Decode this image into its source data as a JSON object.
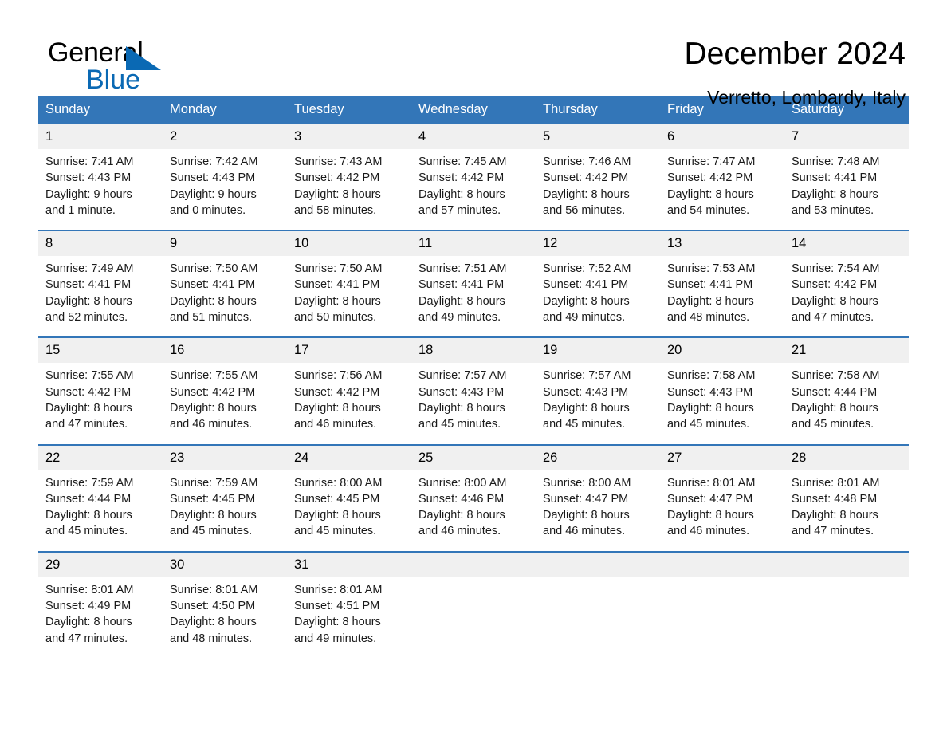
{
  "brand": {
    "name_part1": "General",
    "name_part2": "Blue",
    "accent_color": "#0a69b4"
  },
  "header": {
    "month_title": "December 2024",
    "location": "Verretto, Lombardy, Italy"
  },
  "calendar": {
    "header_color": "#3376b8",
    "day_band_color": "#f0f0f0",
    "weekdays": [
      "Sunday",
      "Monday",
      "Tuesday",
      "Wednesday",
      "Thursday",
      "Friday",
      "Saturday"
    ],
    "weeks": [
      [
        {
          "day": "1",
          "sunrise": "Sunrise: 7:41 AM",
          "sunset": "Sunset: 4:43 PM",
          "daylight_line1": "Daylight: 9 hours",
          "daylight_line2": "and 1 minute."
        },
        {
          "day": "2",
          "sunrise": "Sunrise: 7:42 AM",
          "sunset": "Sunset: 4:43 PM",
          "daylight_line1": "Daylight: 9 hours",
          "daylight_line2": "and 0 minutes."
        },
        {
          "day": "3",
          "sunrise": "Sunrise: 7:43 AM",
          "sunset": "Sunset: 4:42 PM",
          "daylight_line1": "Daylight: 8 hours",
          "daylight_line2": "and 58 minutes."
        },
        {
          "day": "4",
          "sunrise": "Sunrise: 7:45 AM",
          "sunset": "Sunset: 4:42 PM",
          "daylight_line1": "Daylight: 8 hours",
          "daylight_line2": "and 57 minutes."
        },
        {
          "day": "5",
          "sunrise": "Sunrise: 7:46 AM",
          "sunset": "Sunset: 4:42 PM",
          "daylight_line1": "Daylight: 8 hours",
          "daylight_line2": "and 56 minutes."
        },
        {
          "day": "6",
          "sunrise": "Sunrise: 7:47 AM",
          "sunset": "Sunset: 4:42 PM",
          "daylight_line1": "Daylight: 8 hours",
          "daylight_line2": "and 54 minutes."
        },
        {
          "day": "7",
          "sunrise": "Sunrise: 7:48 AM",
          "sunset": "Sunset: 4:41 PM",
          "daylight_line1": "Daylight: 8 hours",
          "daylight_line2": "and 53 minutes."
        }
      ],
      [
        {
          "day": "8",
          "sunrise": "Sunrise: 7:49 AM",
          "sunset": "Sunset: 4:41 PM",
          "daylight_line1": "Daylight: 8 hours",
          "daylight_line2": "and 52 minutes."
        },
        {
          "day": "9",
          "sunrise": "Sunrise: 7:50 AM",
          "sunset": "Sunset: 4:41 PM",
          "daylight_line1": "Daylight: 8 hours",
          "daylight_line2": "and 51 minutes."
        },
        {
          "day": "10",
          "sunrise": "Sunrise: 7:50 AM",
          "sunset": "Sunset: 4:41 PM",
          "daylight_line1": "Daylight: 8 hours",
          "daylight_line2": "and 50 minutes."
        },
        {
          "day": "11",
          "sunrise": "Sunrise: 7:51 AM",
          "sunset": "Sunset: 4:41 PM",
          "daylight_line1": "Daylight: 8 hours",
          "daylight_line2": "and 49 minutes."
        },
        {
          "day": "12",
          "sunrise": "Sunrise: 7:52 AM",
          "sunset": "Sunset: 4:41 PM",
          "daylight_line1": "Daylight: 8 hours",
          "daylight_line2": "and 49 minutes."
        },
        {
          "day": "13",
          "sunrise": "Sunrise: 7:53 AM",
          "sunset": "Sunset: 4:41 PM",
          "daylight_line1": "Daylight: 8 hours",
          "daylight_line2": "and 48 minutes."
        },
        {
          "day": "14",
          "sunrise": "Sunrise: 7:54 AM",
          "sunset": "Sunset: 4:42 PM",
          "daylight_line1": "Daylight: 8 hours",
          "daylight_line2": "and 47 minutes."
        }
      ],
      [
        {
          "day": "15",
          "sunrise": "Sunrise: 7:55 AM",
          "sunset": "Sunset: 4:42 PM",
          "daylight_line1": "Daylight: 8 hours",
          "daylight_line2": "and 47 minutes."
        },
        {
          "day": "16",
          "sunrise": "Sunrise: 7:55 AM",
          "sunset": "Sunset: 4:42 PM",
          "daylight_line1": "Daylight: 8 hours",
          "daylight_line2": "and 46 minutes."
        },
        {
          "day": "17",
          "sunrise": "Sunrise: 7:56 AM",
          "sunset": "Sunset: 4:42 PM",
          "daylight_line1": "Daylight: 8 hours",
          "daylight_line2": "and 46 minutes."
        },
        {
          "day": "18",
          "sunrise": "Sunrise: 7:57 AM",
          "sunset": "Sunset: 4:43 PM",
          "daylight_line1": "Daylight: 8 hours",
          "daylight_line2": "and 45 minutes."
        },
        {
          "day": "19",
          "sunrise": "Sunrise: 7:57 AM",
          "sunset": "Sunset: 4:43 PM",
          "daylight_line1": "Daylight: 8 hours",
          "daylight_line2": "and 45 minutes."
        },
        {
          "day": "20",
          "sunrise": "Sunrise: 7:58 AM",
          "sunset": "Sunset: 4:43 PM",
          "daylight_line1": "Daylight: 8 hours",
          "daylight_line2": "and 45 minutes."
        },
        {
          "day": "21",
          "sunrise": "Sunrise: 7:58 AM",
          "sunset": "Sunset: 4:44 PM",
          "daylight_line1": "Daylight: 8 hours",
          "daylight_line2": "and 45 minutes."
        }
      ],
      [
        {
          "day": "22",
          "sunrise": "Sunrise: 7:59 AM",
          "sunset": "Sunset: 4:44 PM",
          "daylight_line1": "Daylight: 8 hours",
          "daylight_line2": "and 45 minutes."
        },
        {
          "day": "23",
          "sunrise": "Sunrise: 7:59 AM",
          "sunset": "Sunset: 4:45 PM",
          "daylight_line1": "Daylight: 8 hours",
          "daylight_line2": "and 45 minutes."
        },
        {
          "day": "24",
          "sunrise": "Sunrise: 8:00 AM",
          "sunset": "Sunset: 4:45 PM",
          "daylight_line1": "Daylight: 8 hours",
          "daylight_line2": "and 45 minutes."
        },
        {
          "day": "25",
          "sunrise": "Sunrise: 8:00 AM",
          "sunset": "Sunset: 4:46 PM",
          "daylight_line1": "Daylight: 8 hours",
          "daylight_line2": "and 46 minutes."
        },
        {
          "day": "26",
          "sunrise": "Sunrise: 8:00 AM",
          "sunset": "Sunset: 4:47 PM",
          "daylight_line1": "Daylight: 8 hours",
          "daylight_line2": "and 46 minutes."
        },
        {
          "day": "27",
          "sunrise": "Sunrise: 8:01 AM",
          "sunset": "Sunset: 4:47 PM",
          "daylight_line1": "Daylight: 8 hours",
          "daylight_line2": "and 46 minutes."
        },
        {
          "day": "28",
          "sunrise": "Sunrise: 8:01 AM",
          "sunset": "Sunset: 4:48 PM",
          "daylight_line1": "Daylight: 8 hours",
          "daylight_line2": "and 47 minutes."
        }
      ],
      [
        {
          "day": "29",
          "sunrise": "Sunrise: 8:01 AM",
          "sunset": "Sunset: 4:49 PM",
          "daylight_line1": "Daylight: 8 hours",
          "daylight_line2": "and 47 minutes."
        },
        {
          "day": "30",
          "sunrise": "Sunrise: 8:01 AM",
          "sunset": "Sunset: 4:50 PM",
          "daylight_line1": "Daylight: 8 hours",
          "daylight_line2": "and 48 minutes."
        },
        {
          "day": "31",
          "sunrise": "Sunrise: 8:01 AM",
          "sunset": "Sunset: 4:51 PM",
          "daylight_line1": "Daylight: 8 hours",
          "daylight_line2": "and 49 minutes."
        },
        {
          "day": "",
          "sunrise": "",
          "sunset": "",
          "daylight_line1": "",
          "daylight_line2": ""
        },
        {
          "day": "",
          "sunrise": "",
          "sunset": "",
          "daylight_line1": "",
          "daylight_line2": ""
        },
        {
          "day": "",
          "sunrise": "",
          "sunset": "",
          "daylight_line1": "",
          "daylight_line2": ""
        },
        {
          "day": "",
          "sunrise": "",
          "sunset": "",
          "daylight_line1": "",
          "daylight_line2": ""
        }
      ]
    ]
  }
}
